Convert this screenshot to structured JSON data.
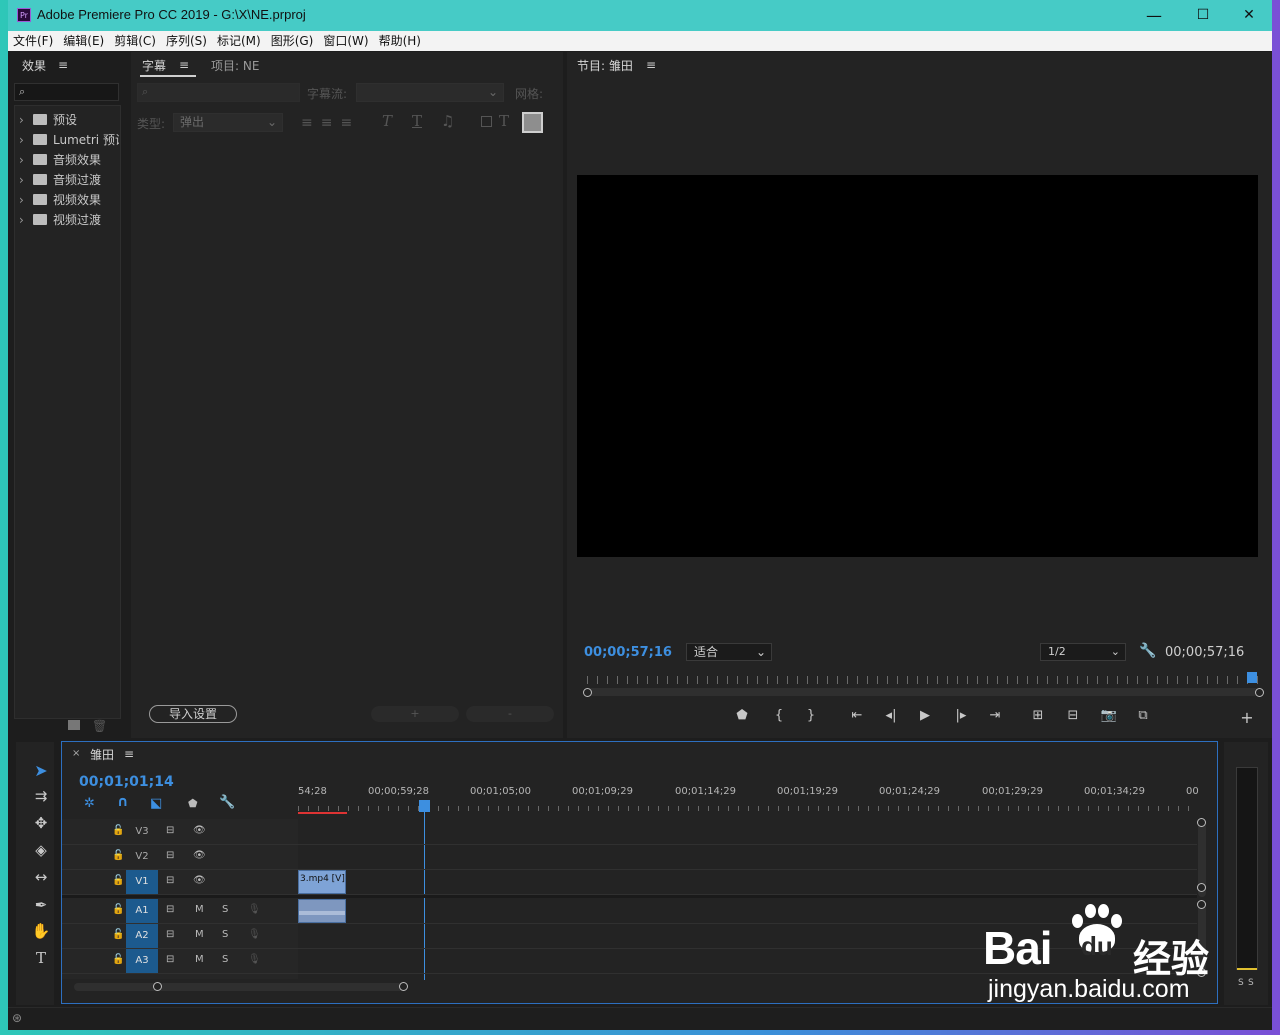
{
  "window": {
    "title": "Adobe Premiere Pro CC 2019 - G:\\X\\NE.prproj",
    "app_icon": "Pr",
    "minimize": "—",
    "maximize": "☐",
    "close": "✕"
  },
  "menu": [
    "文件(F)",
    "编辑(E)",
    "剪辑(C)",
    "序列(S)",
    "标记(M)",
    "图形(G)",
    "窗口(W)",
    "帮助(H)"
  ],
  "effects": {
    "tab": "效果",
    "items": [
      {
        "label": "预设",
        "icon": "star-folder-icon"
      },
      {
        "label": "Lumetri 预设",
        "icon": "star-folder-icon"
      },
      {
        "label": "音频效果",
        "icon": "folder-icon"
      },
      {
        "label": "音频过渡",
        "icon": "folder-icon"
      },
      {
        "label": "视频效果",
        "icon": "folder-icon"
      },
      {
        "label": "视频过渡",
        "icon": "folder-icon"
      }
    ]
  },
  "captions": {
    "tab": "字幕",
    "project_tab": "项目: NE",
    "stream_label": "字幕流:",
    "grid_label": "网格:",
    "type_label": "类型:",
    "type_value": "弹出",
    "import_button": "导入设置",
    "add": "+",
    "remove": "-"
  },
  "program": {
    "tab": "节目: 雏田",
    "timecode": "00;00;57;16",
    "fit": "适合",
    "resolution": "1/2",
    "duration": "00;00;57;16"
  },
  "timeline": {
    "tab": "雏田",
    "timecode": "00;01;01;14",
    "ruler": [
      "54;28",
      "00;00;59;28",
      "00;01;05;00",
      "00;01;09;29",
      "00;01;14;29",
      "00;01;19;29",
      "00;01;24;29",
      "00;01;29;29",
      "00;01;34;29",
      "00"
    ],
    "tracks": [
      {
        "name": "V3",
        "type": "video",
        "active": false
      },
      {
        "name": "V2",
        "type": "video",
        "active": false
      },
      {
        "name": "V1",
        "type": "video",
        "active": true
      },
      {
        "name": "A1",
        "type": "audio",
        "active": true
      },
      {
        "name": "A2",
        "type": "audio",
        "active": true
      },
      {
        "name": "A3",
        "type": "audio",
        "active": true
      }
    ],
    "mute": "M",
    "solo": "S",
    "clip_label": "3.mp4 [V]"
  },
  "audio_meter": {
    "solo_left": "S",
    "solo_right": "S"
  },
  "watermark": {
    "brand": "Bai",
    "brand2": "du",
    "suffix": "经验",
    "url": "jingyan.baidu.com"
  }
}
